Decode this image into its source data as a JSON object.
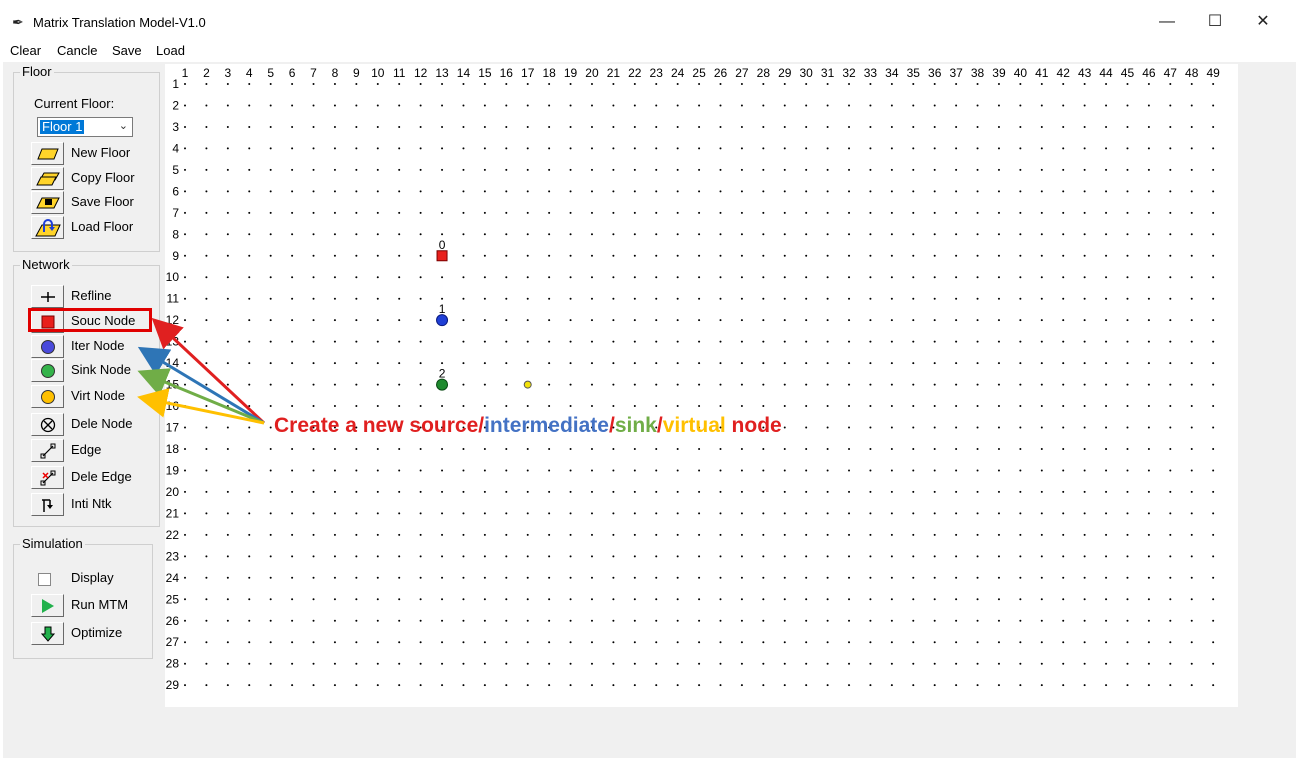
{
  "window": {
    "title": "Matrix Translation Model-V1.0",
    "app_icon": "feather-icon",
    "controls": {
      "minimize": "—",
      "maximize": "☐",
      "close": "✕"
    }
  },
  "menu": [
    "Clear",
    "Cancle",
    "Save",
    "Load"
  ],
  "floor_panel": {
    "title": "Floor",
    "current_floor_label": "Current Floor:",
    "current_floor_value": "Floor 1",
    "buttons": [
      "New Floor",
      "Copy Floor",
      "Save Floor",
      "Load Floor"
    ]
  },
  "network_panel": {
    "title": "Network",
    "buttons": [
      "Refline",
      "Souc Node",
      "Iter Node",
      "Sink Node",
      "Virt Node",
      "Dele Node",
      "Edge",
      "Dele Edge",
      "Inti Ntk"
    ]
  },
  "simulation_panel": {
    "title": "Simulation",
    "display_label": "Display",
    "display_checked": false,
    "buttons": [
      "Run MTM",
      "Optimize"
    ]
  },
  "grid": {
    "columns": 49,
    "rows": 29,
    "nodes": [
      {
        "id": "0",
        "type": "source",
        "col": 13,
        "row": 9,
        "label": "0"
      },
      {
        "id": "1",
        "type": "intermediate",
        "col": 13,
        "row": 12,
        "label": "1"
      },
      {
        "id": "2",
        "type": "sink",
        "col": 13,
        "row": 15,
        "label": "2"
      },
      {
        "id": "v",
        "type": "virtual",
        "col": 17,
        "row": 15,
        "label": ""
      }
    ]
  },
  "annotation": {
    "parts": [
      {
        "text": "Create a new source/",
        "color": "#e02020"
      },
      {
        "text": "intermediate",
        "color": "#4472c4"
      },
      {
        "text": "/",
        "color": "#e02020"
      },
      {
        "text": "sink",
        "color": "#70ad47"
      },
      {
        "text": "/",
        "color": "#e02020"
      },
      {
        "text": "virtual",
        "color": "#ffc000"
      },
      {
        "text": " node",
        "color": "#e02020"
      }
    ]
  },
  "colors": {
    "source": "#e8201c",
    "intermediate": "#1f3fd6",
    "sink": "#1e8a2e",
    "virtual": "#f2e10a",
    "highlight": "#e00000"
  }
}
